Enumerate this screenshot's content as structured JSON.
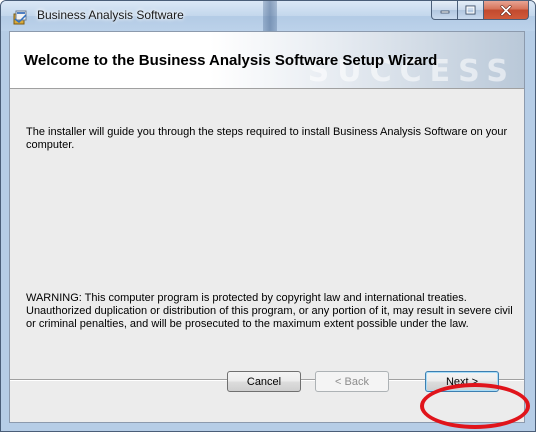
{
  "window": {
    "title": "Business Analysis Software",
    "controls": {
      "minimize": "minimize-icon",
      "maximize": "maximize-icon",
      "close": "close-icon"
    }
  },
  "banner": {
    "title": "Welcome to the Business Analysis Software Setup Wizard",
    "watermark": "SUCCESS"
  },
  "body": {
    "intro": "The installer will guide you through the steps required to install Business Analysis Software on your computer.",
    "warning": "WARNING: This computer program is protected by copyright law and international treaties. Unauthorized duplication or distribution of this program, or any portion of it, may result in severe civil or criminal penalties, and will be prosecuted to the maximum extent possible under the law."
  },
  "buttons": {
    "cancel": "Cancel",
    "back": "< Back",
    "next": "Next >"
  },
  "annotation": {
    "highlight_color": "#e0141b",
    "highlight_target": "next-button"
  }
}
